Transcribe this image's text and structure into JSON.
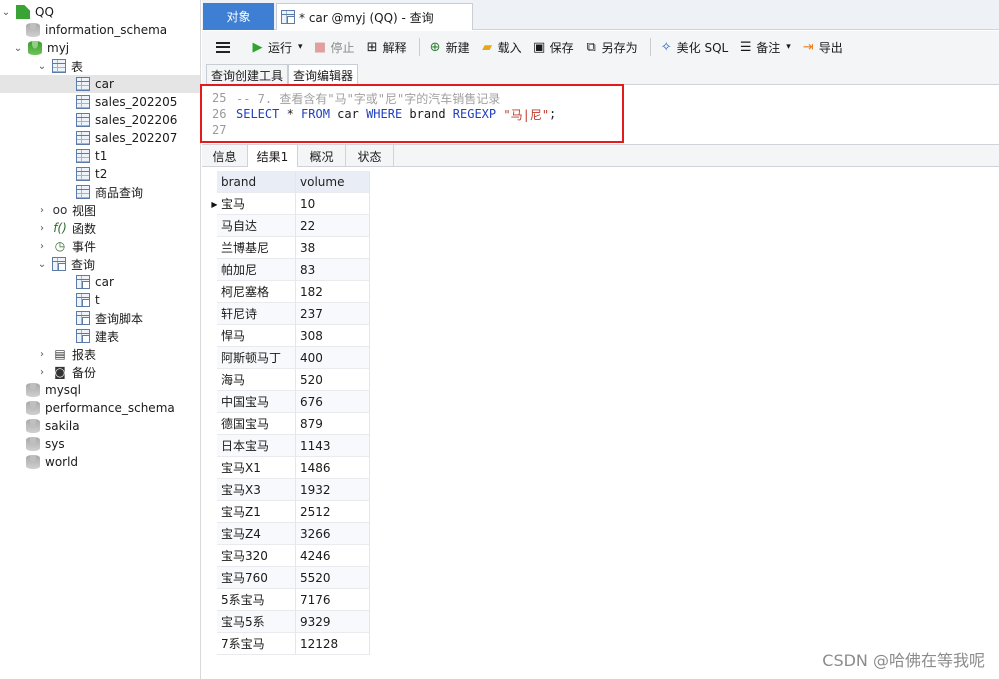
{
  "sidebar": {
    "connection": "QQ",
    "databases_top": [
      "information_schema"
    ],
    "current_db": "myj",
    "tables_group": "表",
    "tables": [
      "car",
      "sales_202205",
      "sales_202206",
      "sales_202207",
      "t1",
      "t2",
      "商品查询"
    ],
    "views": "视图",
    "functions": "函数",
    "events": "事件",
    "queries_group": "查询",
    "queries": [
      "car",
      "t",
      "查询脚本",
      "建表"
    ],
    "reports": "报表",
    "backups": "备份",
    "databases_bottom": [
      "mysql",
      "performance_schema",
      "sakila",
      "sys",
      "world"
    ]
  },
  "tabs": {
    "object": "对象",
    "query": "* car @myj (QQ) - 查询"
  },
  "toolbar": {
    "run": "运行",
    "stop": "停止",
    "explain": "解释",
    "new": "新建",
    "load": "载入",
    "save": "保存",
    "save_as": "另存为",
    "beautify": "美化 SQL",
    "note": "备注",
    "export": "导出"
  },
  "subtabs": {
    "builder": "查询创建工具",
    "editor": "查询编辑器"
  },
  "editor": {
    "lines": [
      {
        "num": "25",
        "comment": "-- 7. 查看含有\"马\"字或\"尼\"字的汽车销售记录"
      },
      {
        "num": "26",
        "select": "SELECT",
        "star": " * ",
        "from": "FROM",
        "table": " car ",
        "where": "WHERE",
        "col": " brand ",
        "regexp": "REGEXP",
        "str": " \"马|尼\"",
        "end": ";"
      },
      {
        "num": "27"
      }
    ]
  },
  "result_tabs": [
    "信息",
    "结果1",
    "概况",
    "状态"
  ],
  "grid": {
    "columns": [
      "brand",
      "volume"
    ],
    "rows": [
      [
        "宝马",
        "10"
      ],
      [
        "马自达",
        "22"
      ],
      [
        "兰博基尼",
        "38"
      ],
      [
        "帕加尼",
        "83"
      ],
      [
        "柯尼塞格",
        "182"
      ],
      [
        "轩尼诗",
        "237"
      ],
      [
        "悍马",
        "308"
      ],
      [
        "阿斯顿马丁",
        "400"
      ],
      [
        "海马",
        "520"
      ],
      [
        "中国宝马",
        "676"
      ],
      [
        "德国宝马",
        "879"
      ],
      [
        "日本宝马",
        "1143"
      ],
      [
        "宝马X1",
        "1486"
      ],
      [
        "宝马X3",
        "1932"
      ],
      [
        "宝马Z1",
        "2512"
      ],
      [
        "宝马Z4",
        "3266"
      ],
      [
        "宝马320",
        "4246"
      ],
      [
        "宝马760",
        "5520"
      ],
      [
        "5系宝马",
        "7176"
      ],
      [
        "宝马5系",
        "9329"
      ],
      [
        "7系宝马",
        "12128"
      ]
    ]
  },
  "watermark": "CSDN @哈佛在等我呢"
}
